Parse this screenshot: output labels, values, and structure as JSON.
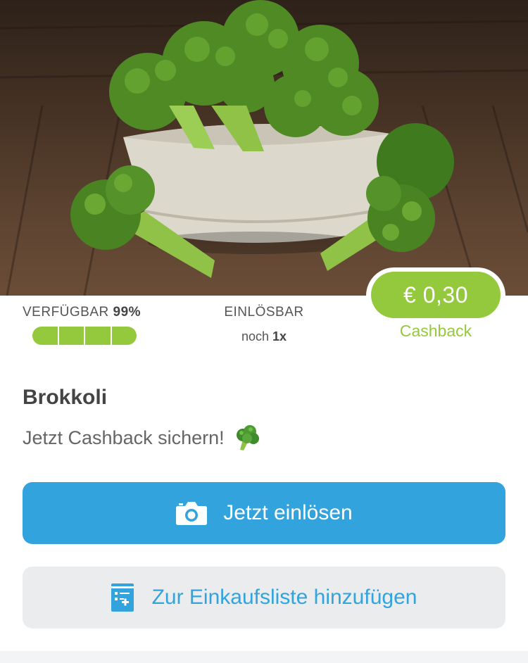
{
  "hero": {
    "image_name": "broccoli-bowl-photo"
  },
  "availability": {
    "label": "VERFÜGBAR",
    "percent_text": "99%",
    "fill_fraction": 0.99
  },
  "redeemable": {
    "label": "EINLÖSBAR",
    "prefix": "noch",
    "count": "1x"
  },
  "cashback": {
    "amount": "€ 0,30",
    "label": "Cashback"
  },
  "product": {
    "title": "Brokkoli",
    "subtitle": "Jetzt Cashback sichern!",
    "emoji_icon": "broccoli-icon"
  },
  "actions": {
    "redeem_label": "Jetzt einlösen",
    "redeem_icon": "camera-icon",
    "list_label": "Zur Einkaufsliste hinzufügen",
    "list_icon": "shopping-list-add-icon"
  },
  "colors": {
    "accent_green": "#95c93d",
    "primary_blue": "#33a3dd",
    "secondary_bg": "#ebecee"
  }
}
